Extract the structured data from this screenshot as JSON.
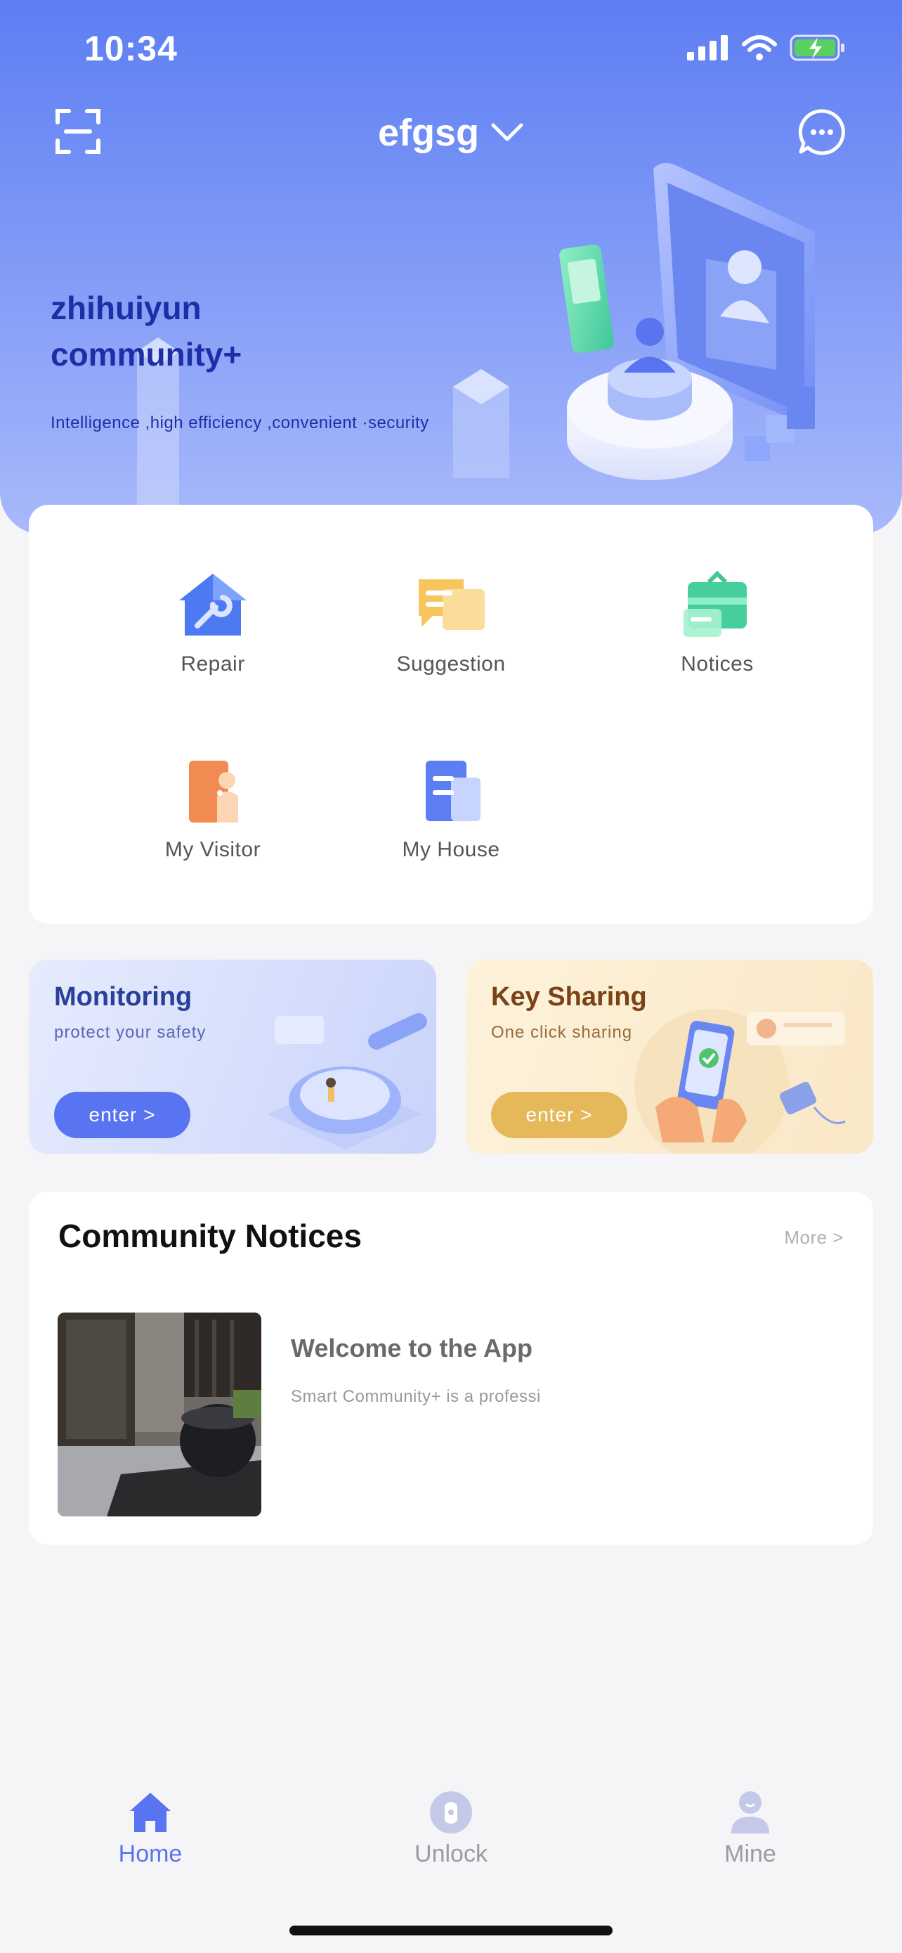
{
  "status_bar": {
    "time": "10:34",
    "icons": [
      "cellular-signal-icon",
      "wifi-icon",
      "battery-charging-icon"
    ]
  },
  "header": {
    "community_name": "efgsg",
    "hero_title_line1": "zhihuiyun",
    "hero_title_line2": "community+",
    "hero_subtitle": "Intelligence ,high efficiency ,convenient ·security",
    "left_icon": "scan-icon",
    "right_icon": "message-icon"
  },
  "services": [
    {
      "label": "Repair",
      "icon": "repair-house-icon"
    },
    {
      "label": "Suggestion",
      "icon": "suggestion-icon"
    },
    {
      "label": "Notices",
      "icon": "notices-icon"
    },
    {
      "label": "My Visitor",
      "icon": "visitor-door-icon"
    },
    {
      "label": "My House",
      "icon": "house-building-icon"
    }
  ],
  "features": {
    "monitoring": {
      "title": "Monitoring",
      "subtitle": "protect your safety",
      "button": "enter >"
    },
    "key_sharing": {
      "title": "Key Sharing",
      "subtitle": "One click sharing",
      "button": "enter >"
    }
  },
  "notices": {
    "title": "Community Notices",
    "more": "More >",
    "items": [
      {
        "title": "Welcome to the App",
        "desc": "Smart Community+ is a professi"
      }
    ]
  },
  "tabs": [
    {
      "label": "Home",
      "icon": "home-icon",
      "active": true
    },
    {
      "label": "Unlock",
      "icon": "unlock-icon",
      "active": false
    },
    {
      "label": "Mine",
      "icon": "person-icon",
      "active": false
    }
  ],
  "colors": {
    "accent": "#5874f0",
    "inactive": "#9b9ba0",
    "key_gold": "#e5b85a"
  }
}
